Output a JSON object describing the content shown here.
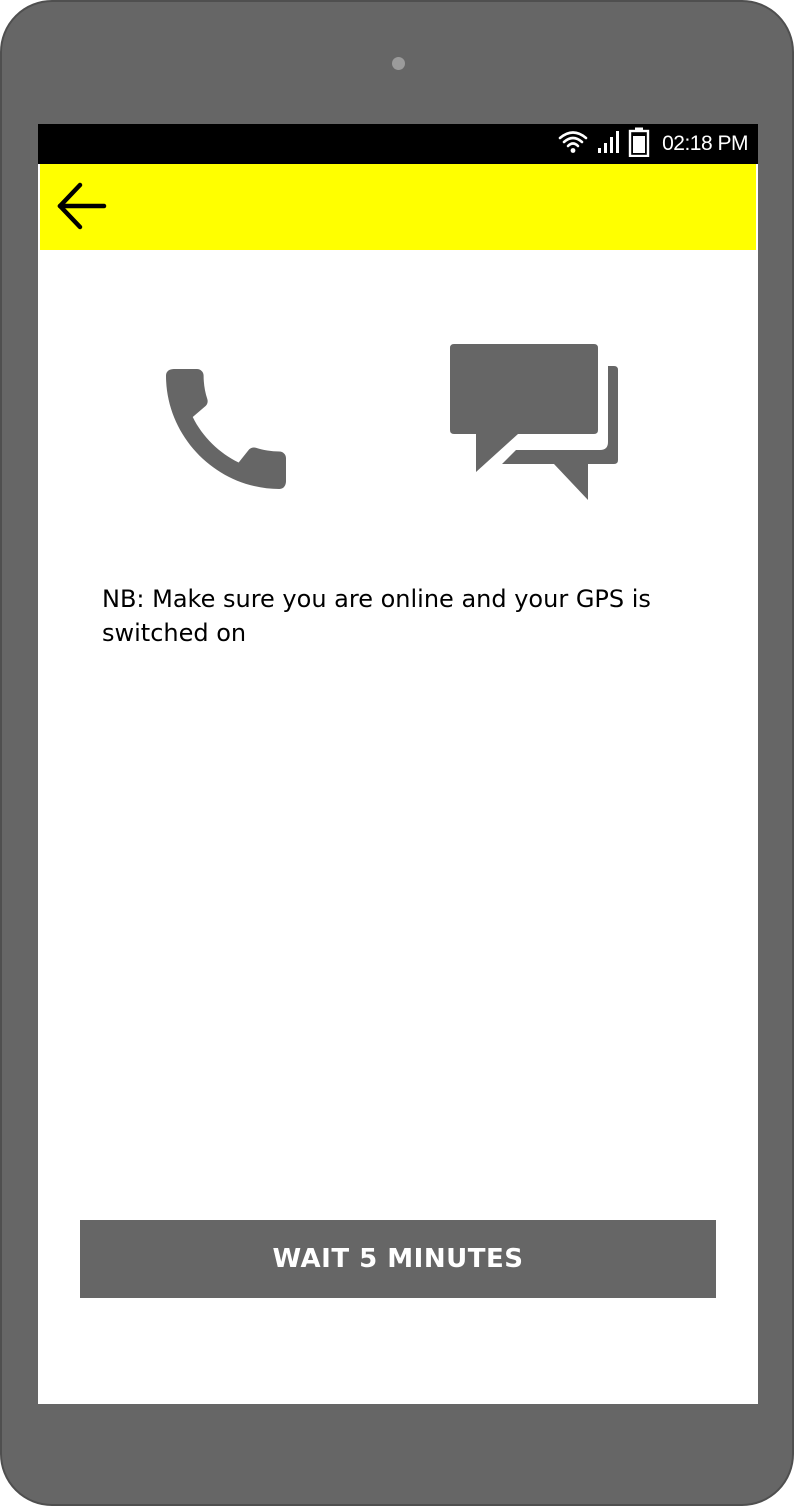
{
  "status_bar": {
    "time": "02:18 PM",
    "icons": [
      "wifi-icon",
      "signal-icon",
      "battery-icon"
    ]
  },
  "app_bar": {
    "back_icon": "arrow-left-icon",
    "color": "#ffff00"
  },
  "actions": {
    "call_icon": "phone-icon",
    "message_icon": "chat-bubbles-icon"
  },
  "notice": {
    "text": "NB: Make sure you are online and your GPS is switched on"
  },
  "footer": {
    "wait_button_label": "WAIT 5 MINUTES"
  },
  "colors": {
    "device_frame": "#666666",
    "icon_gray": "#666666",
    "button_bg": "#666666",
    "button_text": "#ffffff"
  }
}
